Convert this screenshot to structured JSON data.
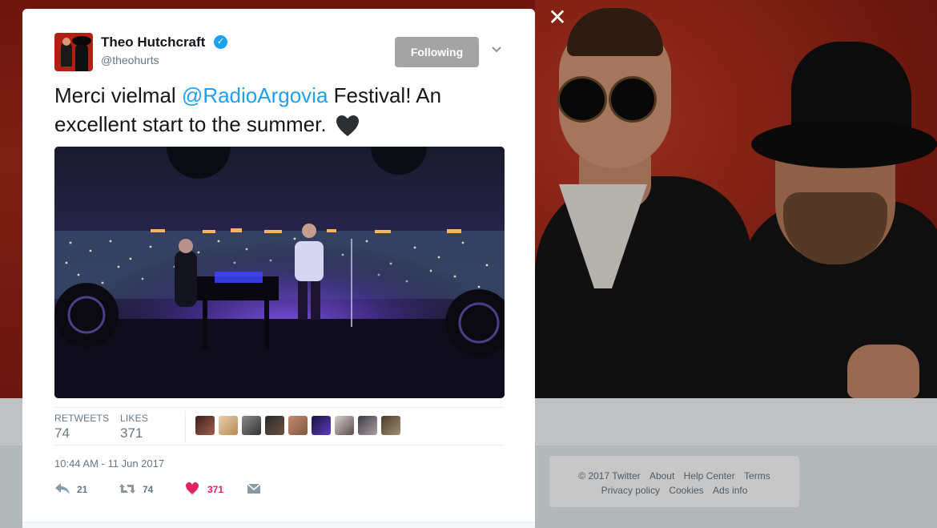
{
  "tweet": {
    "author_name": "Theo Hutchcraft",
    "author_handle": "@theohurts",
    "follow_button_label": "Following",
    "text_before": "Merci vielmal ",
    "mention": "@RadioArgovia",
    "text_after": " Festival! An excellent start to the summer.",
    "emoji": "black-heart",
    "timestamp": "10:44 AM - 11 Jun 2017"
  },
  "stats": {
    "retweets_label": "RETWEETS",
    "retweets_value": "74",
    "likes_label": "LIKES",
    "likes_value": "371"
  },
  "actions": {
    "reply_count": "21",
    "retweet_count": "74",
    "like_count": "371"
  },
  "footer": {
    "copyright": "© 2017 Twitter",
    "about": "About",
    "help_center": "Help Center",
    "terms": "Terms",
    "privacy": "Privacy policy",
    "cookies": "Cookies",
    "ads_info": "Ads info"
  },
  "colors": {
    "link_blue": "#1da1f2",
    "like_red": "#e0245e",
    "following_button": "#a4a4a4",
    "meta_gray": "#657786"
  },
  "icons": [
    "close-icon",
    "verified-badge-icon",
    "chevron-down-icon",
    "reply-icon",
    "retweet-icon",
    "heart-icon",
    "direct-message-icon"
  ]
}
